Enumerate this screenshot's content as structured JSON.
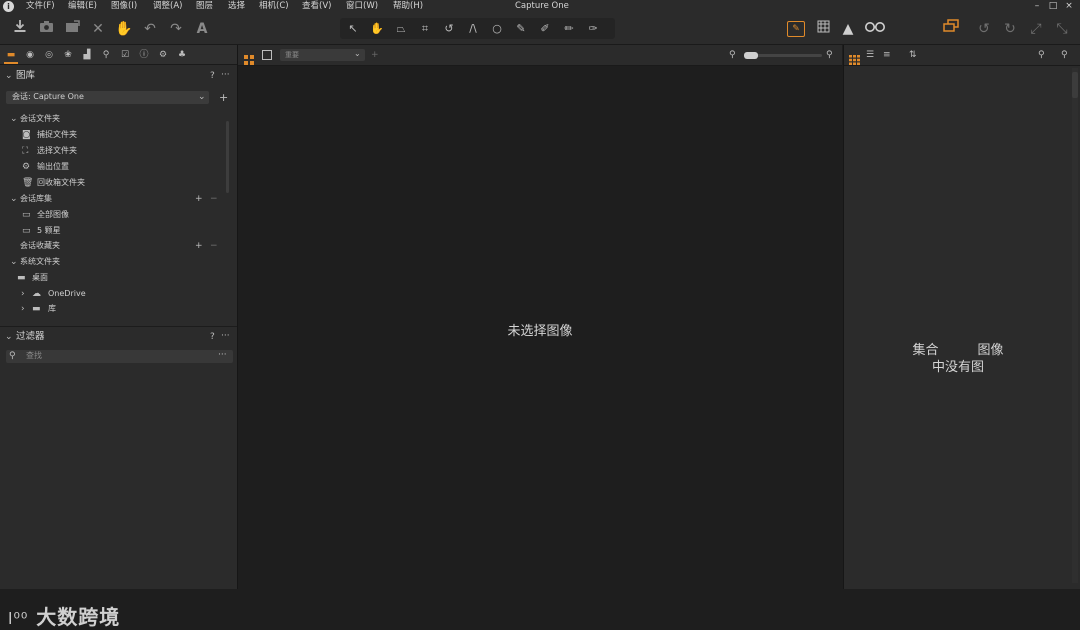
{
  "app": {
    "title": "Capture One"
  },
  "menu": {
    "items": [
      "文件(F)",
      "编辑(E)",
      "图像(I)",
      "调整(A)",
      "图层",
      "选择",
      "相机(C)",
      "查看(V)",
      "窗口(W)",
      "帮助(H)"
    ]
  },
  "window_controls": {
    "minimize": "–",
    "maximize": "□",
    "close": "×"
  },
  "toolbar": {
    "left_icons": [
      "import-icon",
      "camera-icon",
      "export-icon",
      "delete-icon",
      "hand-icon",
      "undo-icon",
      "redo-icon",
      "text-icon"
    ],
    "cursor_tools": [
      "select-arrow-icon",
      "pan-hand-icon",
      "keystone-icon",
      "crop-icon",
      "rotate-icon",
      "straighten-icon",
      "spot-icon",
      "brush-icon",
      "pen-icon",
      "eraser-icon",
      "gradient-icon"
    ],
    "right_icons": [
      "exposure-warning-icon",
      "grid-icon",
      "warning-icon",
      "glasses-icon",
      "stack-icon",
      "rotate-left-icon",
      "rotate-right-icon",
      "expand-icon",
      "collapse-icon"
    ],
    "accent_color": "#e08a2a"
  },
  "library": {
    "title": "图库",
    "session": "会话: Capture One",
    "session_folders_label": "会话文件夹",
    "session_folders": [
      "捕捉文件夹",
      "选择文件夹",
      "输出位置",
      "回收箱文件夹"
    ],
    "session_albums_label": "会话库集",
    "session_albums": [
      "全部图像",
      "5 颗星"
    ],
    "session_favorites_label": "会话收藏夹",
    "system_folders_label": "系统文件夹",
    "system_folders": [
      "桌面",
      "OneDrive",
      "库"
    ]
  },
  "filters": {
    "title": "过滤器",
    "search_placeholder": "查找"
  },
  "viewer": {
    "sort_placeholder": "重要",
    "empty_message": "未选择图像"
  },
  "browser": {
    "empty_line1": "集合　　　图像",
    "empty_line2": "中没有图"
  },
  "watermark": "大数跨境"
}
